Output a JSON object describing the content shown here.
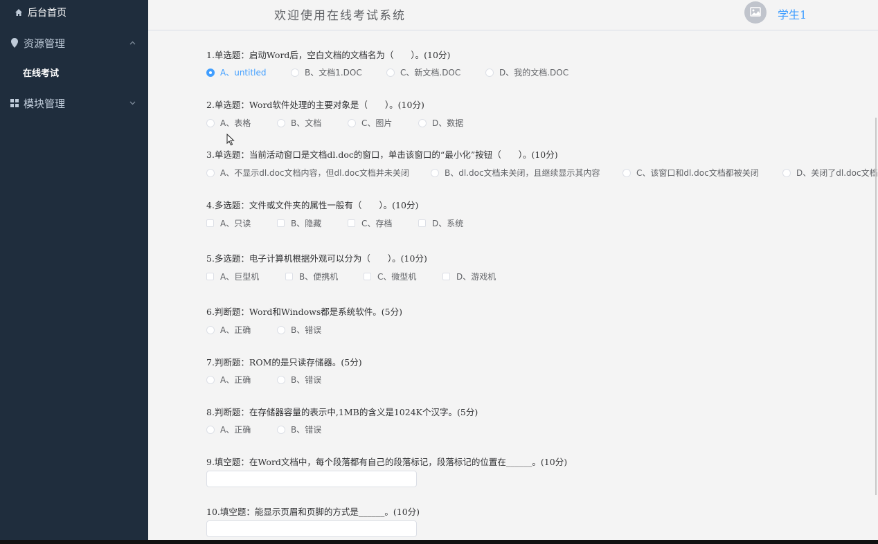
{
  "sidebar": {
    "home_label": "后台首页",
    "resource_label": "资源管理",
    "exam_label": "在线考试",
    "module_label": "模块管理"
  },
  "header": {
    "title": "欢迎使用在线考试系统",
    "username": "学生1"
  },
  "questions": [
    {
      "title": "1.单选题：启动Word后，空白文档的文档名为（　　）。(10分)",
      "type": "radio",
      "selected": 0,
      "options": [
        "A、untitled",
        "B、文档1.DOC",
        "C、新文档.DOC",
        "D、我的文档.DOC"
      ]
    },
    {
      "title": "2.单选题：Word软件处理的主要对象是（　　）。(10分)",
      "type": "radio",
      "selected": -1,
      "options": [
        "A、表格",
        "B、文档",
        "C、图片",
        "D、数据"
      ]
    },
    {
      "title": "3.单选题：当前活动窗口是文档dl.doc的窗口，单击该窗口的“最小化”按钮（　　）。(10分)",
      "type": "radio",
      "selected": -1,
      "options": [
        "A、不显示dl.doc文档内容，但dl.doc文档并未关闭",
        "B、dl.doc文档未关闭，且继续显示其内容",
        "C、该窗口和dl.doc文档都被关闭",
        "D、关闭了dl.doc文档"
      ]
    },
    {
      "title": "4.多选题：文件或文件夹的属性一般有（　　）。(10分)",
      "type": "checkbox",
      "options": [
        "A、只读",
        "B、隐藏",
        "C、存档",
        "D、系统"
      ]
    },
    {
      "title": "5.多选题：电子计算机根据外观可以分为（　　）。(10分)",
      "type": "checkbox",
      "options": [
        "A、巨型机",
        "B、便携机",
        "C、微型机",
        "D、游戏机"
      ]
    },
    {
      "title": "6.判断题：Word和Windows都是系统软件。(5分)",
      "type": "radio",
      "selected": -1,
      "options": [
        "A、正确",
        "B、错误"
      ]
    },
    {
      "title": "7.判断题：ROM的是只读存储器。(5分)",
      "type": "radio",
      "selected": -1,
      "options": [
        "A、正确",
        "B、错误"
      ]
    },
    {
      "title": "8.判断题：在存储器容量的表示中,1MB的含义是1024K个汉字。(5分)",
      "type": "radio",
      "selected": -1,
      "options": [
        "A、正确",
        "B、错误"
      ]
    },
    {
      "title": "9.填空题：在Word文档中，每个段落都有自己的段落标记，段落标记的位置在______。(10分)",
      "type": "fill",
      "value": ""
    },
    {
      "title": "10.填空题：能显示页眉和页脚的方式是______。(10分)",
      "type": "fill",
      "value": ""
    }
  ],
  "colors": {
    "sidebar_bg": "#1f2d3d",
    "accent": "#409eff"
  },
  "icons": [
    "home-icon",
    "location-icon",
    "chevron-up-icon",
    "grid-icon",
    "chevron-down-icon",
    "image-icon",
    "mouse-cursor-icon"
  ]
}
